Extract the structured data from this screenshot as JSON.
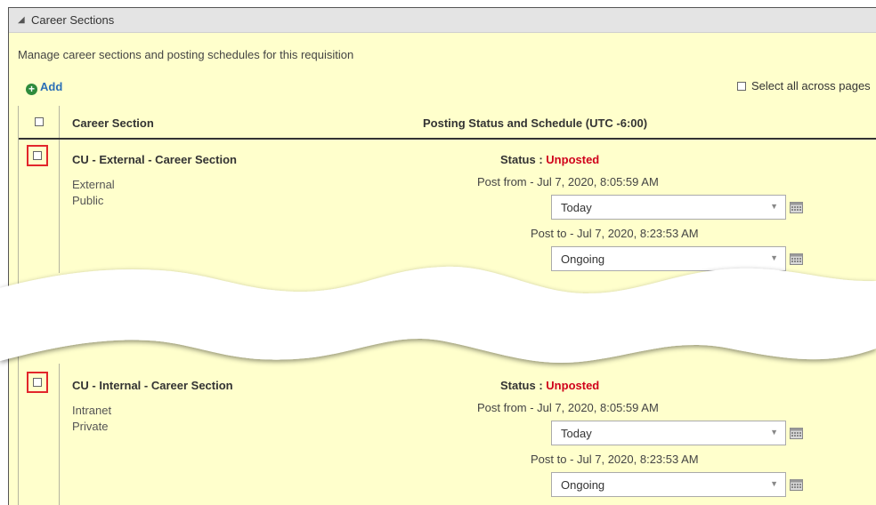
{
  "section": {
    "title": "Career Sections",
    "description": "Manage career sections and posting schedules for this requisition",
    "add_label": "Add",
    "select_all_label": "Select all across pages"
  },
  "table": {
    "headers": {
      "career_section": "Career Section",
      "posting": "Posting Status and Schedule (UTC -6:00)"
    },
    "rows": [
      {
        "name": "CU - External - Career Section",
        "line1": "External",
        "line2": "Public",
        "status_label": "Status",
        "status_value": "Unposted",
        "post_from": "Post from - Jul 7, 2020, 8:05:59 AM",
        "post_from_option": "Today",
        "post_to": "Post to - Jul 7, 2020, 8:23:53 AM",
        "post_to_option": "Ongoing"
      },
      {
        "name": "CU - Internal - Career Section",
        "line1": "Intranet",
        "line2": "Private",
        "status_label": "Status",
        "status_value": "Unposted",
        "post_from": "Post from - Jul 7, 2020, 8:05:59 AM",
        "post_from_option": "Today",
        "post_to": "Post to - Jul 7, 2020, 8:23:53 AM",
        "post_to_option": "Ongoing"
      }
    ]
  },
  "colors": {
    "panel_bg": "#ffffcc",
    "header_bg": "#e4e4e4",
    "unposted": "#d0021b",
    "highlight_box": "#e2262b",
    "link": "#2b6fb6",
    "add_icon": "#2e8b3c"
  },
  "icons": {
    "collapse": "triangle-down-icon",
    "add": "plus-circle-icon",
    "calendar": "calendar-icon",
    "dropdown": "chevron-down-icon"
  }
}
